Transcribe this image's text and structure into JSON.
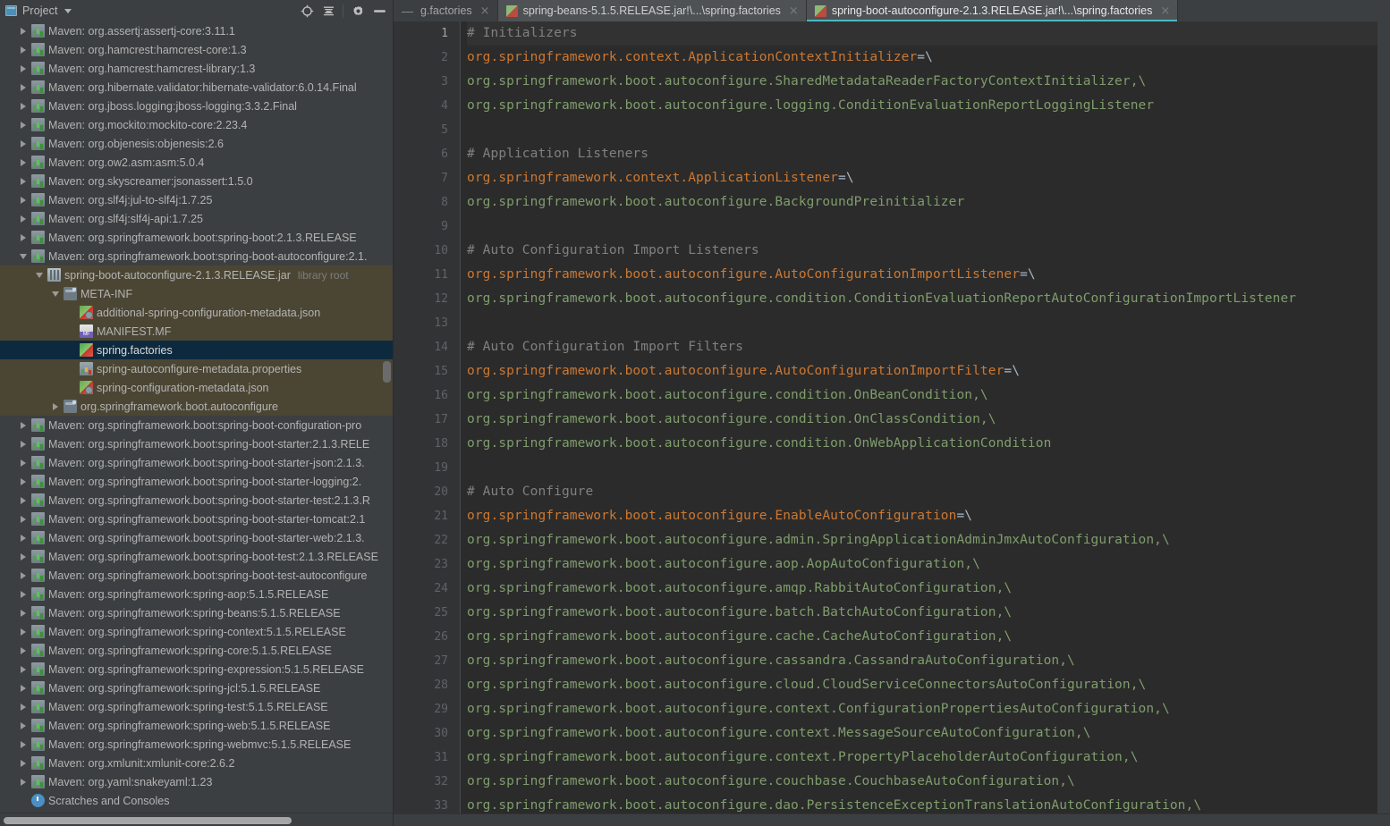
{
  "tool_window": {
    "title": "Project",
    "dropdown_caret": "chevron-down",
    "actions": [
      {
        "name": "locate-icon",
        "glyph": "⊕"
      },
      {
        "name": "collapse-all-icon",
        "glyph": "≡"
      },
      {
        "name": "settings-gear-icon",
        "glyph": "⚙"
      },
      {
        "name": "hide-icon",
        "glyph": "—"
      }
    ]
  },
  "tabs": [
    {
      "label": "g.factories",
      "icon": "properties-file-icon",
      "state": "inactive",
      "closable": true,
      "truncated": true
    },
    {
      "label": "spring-beans-5.1.5.RELEASE.jar!\\...\\spring.factories",
      "icon": "properties-file-icon",
      "state": "active-unfocused",
      "closable": true
    },
    {
      "label": "spring-boot-autoconfigure-2.1.3.RELEASE.jar!\\...\\spring.factories",
      "icon": "properties-file-icon",
      "state": "active",
      "closable": true
    }
  ],
  "tree": [
    {
      "label": "Maven: org.assertj:assertj-core:3.11.1",
      "indent": 0,
      "twisty": "right",
      "icon": "maven-lib-icon"
    },
    {
      "label": "Maven: org.hamcrest:hamcrest-core:1.3",
      "indent": 0,
      "twisty": "right",
      "icon": "maven-lib-icon"
    },
    {
      "label": "Maven: org.hamcrest:hamcrest-library:1.3",
      "indent": 0,
      "twisty": "right",
      "icon": "maven-lib-icon"
    },
    {
      "label": "Maven: org.hibernate.validator:hibernate-validator:6.0.14.Final",
      "indent": 0,
      "twisty": "right",
      "icon": "maven-lib-icon"
    },
    {
      "label": "Maven: org.jboss.logging:jboss-logging:3.3.2.Final",
      "indent": 0,
      "twisty": "right",
      "icon": "maven-lib-icon"
    },
    {
      "label": "Maven: org.mockito:mockito-core:2.23.4",
      "indent": 0,
      "twisty": "right",
      "icon": "maven-lib-icon"
    },
    {
      "label": "Maven: org.objenesis:objenesis:2.6",
      "indent": 0,
      "twisty": "right",
      "icon": "maven-lib-icon"
    },
    {
      "label": "Maven: org.ow2.asm:asm:5.0.4",
      "indent": 0,
      "twisty": "right",
      "icon": "maven-lib-icon"
    },
    {
      "label": "Maven: org.skyscreamer:jsonassert:1.5.0",
      "indent": 0,
      "twisty": "right",
      "icon": "maven-lib-icon"
    },
    {
      "label": "Maven: org.slf4j:jul-to-slf4j:1.7.25",
      "indent": 0,
      "twisty": "right",
      "icon": "maven-lib-icon"
    },
    {
      "label": "Maven: org.slf4j:slf4j-api:1.7.25",
      "indent": 0,
      "twisty": "right",
      "icon": "maven-lib-icon"
    },
    {
      "label": "Maven: org.springframework.boot:spring-boot:2.1.3.RELEASE",
      "indent": 0,
      "twisty": "right",
      "icon": "maven-lib-icon"
    },
    {
      "label": "Maven: org.springframework.boot:spring-boot-autoconfigure:2.1.",
      "indent": 0,
      "twisty": "down",
      "icon": "maven-lib-icon"
    },
    {
      "label": "spring-boot-autoconfigure-2.1.3.RELEASE.jar",
      "sub": "library root",
      "indent": 1,
      "twisty": "down",
      "icon": "jar-icon",
      "highlight": "jar-subtree"
    },
    {
      "label": "META-INF",
      "indent": 2,
      "twisty": "down",
      "icon": "folder-icon",
      "highlight": "jar-subtree"
    },
    {
      "label": "additional-spring-configuration-metadata.json",
      "indent": 3,
      "twisty": "none",
      "icon": "json-file-icon",
      "highlight": "jar-subtree"
    },
    {
      "label": "MANIFEST.MF",
      "indent": 3,
      "twisty": "none",
      "icon": "manifest-file-icon",
      "highlight": "jar-subtree"
    },
    {
      "label": "spring.factories",
      "indent": 3,
      "twisty": "none",
      "icon": "properties-file-icon",
      "highlight": "selected"
    },
    {
      "label": "spring-autoconfigure-metadata.properties",
      "indent": 3,
      "twisty": "none",
      "icon": "properties-file-icon",
      "highlight": "jar-subtree"
    },
    {
      "label": "spring-configuration-metadata.json",
      "indent": 3,
      "twisty": "none",
      "icon": "json-file-icon",
      "highlight": "jar-subtree"
    },
    {
      "label": "org.springframework.boot.autoconfigure",
      "indent": 2,
      "twisty": "right",
      "icon": "folder-icon",
      "highlight": "jar-subtree"
    },
    {
      "label": "Maven: org.springframework.boot:spring-boot-configuration-pro",
      "indent": 0,
      "twisty": "right",
      "icon": "maven-lib-icon"
    },
    {
      "label": "Maven: org.springframework.boot:spring-boot-starter:2.1.3.RELE",
      "indent": 0,
      "twisty": "right",
      "icon": "maven-lib-icon"
    },
    {
      "label": "Maven: org.springframework.boot:spring-boot-starter-json:2.1.3.",
      "indent": 0,
      "twisty": "right",
      "icon": "maven-lib-icon"
    },
    {
      "label": "Maven: org.springframework.boot:spring-boot-starter-logging:2.",
      "indent": 0,
      "twisty": "right",
      "icon": "maven-lib-icon"
    },
    {
      "label": "Maven: org.springframework.boot:spring-boot-starter-test:2.1.3.R",
      "indent": 0,
      "twisty": "right",
      "icon": "maven-lib-icon"
    },
    {
      "label": "Maven: org.springframework.boot:spring-boot-starter-tomcat:2.1",
      "indent": 0,
      "twisty": "right",
      "icon": "maven-lib-icon"
    },
    {
      "label": "Maven: org.springframework.boot:spring-boot-starter-web:2.1.3.",
      "indent": 0,
      "twisty": "right",
      "icon": "maven-lib-icon"
    },
    {
      "label": "Maven: org.springframework.boot:spring-boot-test:2.1.3.RELEASE",
      "indent": 0,
      "twisty": "right",
      "icon": "maven-lib-icon"
    },
    {
      "label": "Maven: org.springframework.boot:spring-boot-test-autoconfigure",
      "indent": 0,
      "twisty": "right",
      "icon": "maven-lib-icon"
    },
    {
      "label": "Maven: org.springframework:spring-aop:5.1.5.RELEASE",
      "indent": 0,
      "twisty": "right",
      "icon": "maven-lib-icon"
    },
    {
      "label": "Maven: org.springframework:spring-beans:5.1.5.RELEASE",
      "indent": 0,
      "twisty": "right",
      "icon": "maven-lib-icon"
    },
    {
      "label": "Maven: org.springframework:spring-context:5.1.5.RELEASE",
      "indent": 0,
      "twisty": "right",
      "icon": "maven-lib-icon"
    },
    {
      "label": "Maven: org.springframework:spring-core:5.1.5.RELEASE",
      "indent": 0,
      "twisty": "right",
      "icon": "maven-lib-icon"
    },
    {
      "label": "Maven: org.springframework:spring-expression:5.1.5.RELEASE",
      "indent": 0,
      "twisty": "right",
      "icon": "maven-lib-icon"
    },
    {
      "label": "Maven: org.springframework:spring-jcl:5.1.5.RELEASE",
      "indent": 0,
      "twisty": "right",
      "icon": "maven-lib-icon"
    },
    {
      "label": "Maven: org.springframework:spring-test:5.1.5.RELEASE",
      "indent": 0,
      "twisty": "right",
      "icon": "maven-lib-icon"
    },
    {
      "label": "Maven: org.springframework:spring-web:5.1.5.RELEASE",
      "indent": 0,
      "twisty": "right",
      "icon": "maven-lib-icon"
    },
    {
      "label": "Maven: org.springframework:spring-webmvc:5.1.5.RELEASE",
      "indent": 0,
      "twisty": "right",
      "icon": "maven-lib-icon"
    },
    {
      "label": "Maven: org.xmlunit:xmlunit-core:2.6.2",
      "indent": 0,
      "twisty": "right",
      "icon": "maven-lib-icon"
    },
    {
      "label": "Maven: org.yaml:snakeyaml:1.23",
      "indent": 0,
      "twisty": "right",
      "icon": "maven-lib-icon"
    },
    {
      "label": "Scratches and Consoles",
      "indent": 0,
      "twisty": "none",
      "icon": "scratches-icon"
    }
  ],
  "editor": {
    "first_visible_line": 1,
    "caret_line": 1,
    "lines": [
      {
        "n": 1,
        "segments": [
          {
            "t": "# Initializers",
            "c": "comment"
          }
        ]
      },
      {
        "n": 2,
        "segments": [
          {
            "t": "org.springframework.context.ApplicationContextInitializer",
            "c": "key"
          },
          {
            "t": "=\\",
            "c": "eq"
          }
        ]
      },
      {
        "n": 3,
        "segments": [
          {
            "t": "org.springframework.boot.autoconfigure.SharedMetadataReaderFactoryContextInitializer,\\",
            "c": "val"
          }
        ]
      },
      {
        "n": 4,
        "segments": [
          {
            "t": "org.springframework.boot.autoconfigure.logging.ConditionEvaluationReportLoggingListener",
            "c": "val"
          }
        ]
      },
      {
        "n": 5,
        "segments": []
      },
      {
        "n": 6,
        "segments": [
          {
            "t": "# Application Listeners",
            "c": "comment"
          }
        ]
      },
      {
        "n": 7,
        "segments": [
          {
            "t": "org.springframework.context.ApplicationListener",
            "c": "key"
          },
          {
            "t": "=\\",
            "c": "eq"
          }
        ]
      },
      {
        "n": 8,
        "segments": [
          {
            "t": "org.springframework.boot.autoconfigure.BackgroundPreinitializer",
            "c": "val"
          }
        ]
      },
      {
        "n": 9,
        "segments": []
      },
      {
        "n": 10,
        "segments": [
          {
            "t": "# Auto Configuration Import Listeners",
            "c": "comment"
          }
        ]
      },
      {
        "n": 11,
        "segments": [
          {
            "t": "org.springframework.boot.autoconfigure.AutoConfigurationImportListener",
            "c": "key"
          },
          {
            "t": "=\\",
            "c": "eq"
          }
        ]
      },
      {
        "n": 12,
        "segments": [
          {
            "t": "org.springframework.boot.autoconfigure.condition.ConditionEvaluationReportAutoConfigurationImportListener",
            "c": "val"
          }
        ]
      },
      {
        "n": 13,
        "segments": []
      },
      {
        "n": 14,
        "segments": [
          {
            "t": "# Auto Configuration Import Filters",
            "c": "comment"
          }
        ]
      },
      {
        "n": 15,
        "segments": [
          {
            "t": "org.springframework.boot.autoconfigure.AutoConfigurationImportFilter",
            "c": "key"
          },
          {
            "t": "=\\",
            "c": "eq"
          }
        ]
      },
      {
        "n": 16,
        "segments": [
          {
            "t": "org.springframework.boot.autoconfigure.condition.OnBeanCondition,\\",
            "c": "val"
          }
        ]
      },
      {
        "n": 17,
        "segments": [
          {
            "t": "org.springframework.boot.autoconfigure.condition.OnClassCondition,\\",
            "c": "val"
          }
        ]
      },
      {
        "n": 18,
        "segments": [
          {
            "t": "org.springframework.boot.autoconfigure.condition.OnWebApplicationCondition",
            "c": "val"
          }
        ]
      },
      {
        "n": 19,
        "segments": []
      },
      {
        "n": 20,
        "segments": [
          {
            "t": "# Auto Configure",
            "c": "comment"
          }
        ]
      },
      {
        "n": 21,
        "segments": [
          {
            "t": "org.springframework.boot.autoconfigure.EnableAutoConfiguration",
            "c": "key"
          },
          {
            "t": "=\\",
            "c": "eq"
          }
        ]
      },
      {
        "n": 22,
        "segments": [
          {
            "t": "org.springframework.boot.autoconfigure.admin.SpringApplicationAdminJmxAutoConfiguration,\\",
            "c": "val"
          }
        ]
      },
      {
        "n": 23,
        "segments": [
          {
            "t": "org.springframework.boot.autoconfigure.aop.AopAutoConfiguration,\\",
            "c": "val"
          }
        ]
      },
      {
        "n": 24,
        "segments": [
          {
            "t": "org.springframework.boot.autoconfigure.amqp.RabbitAutoConfiguration,\\",
            "c": "val"
          }
        ]
      },
      {
        "n": 25,
        "segments": [
          {
            "t": "org.springframework.boot.autoconfigure.batch.BatchAutoConfiguration,\\",
            "c": "val"
          }
        ]
      },
      {
        "n": 26,
        "segments": [
          {
            "t": "org.springframework.boot.autoconfigure.cache.CacheAutoConfiguration,\\",
            "c": "val"
          }
        ]
      },
      {
        "n": 27,
        "segments": [
          {
            "t": "org.springframework.boot.autoconfigure.cassandra.CassandraAutoConfiguration,\\",
            "c": "val"
          }
        ]
      },
      {
        "n": 28,
        "segments": [
          {
            "t": "org.springframework.boot.autoconfigure.cloud.CloudServiceConnectorsAutoConfiguration,\\",
            "c": "val"
          }
        ]
      },
      {
        "n": 29,
        "segments": [
          {
            "t": "org.springframework.boot.autoconfigure.context.ConfigurationPropertiesAutoConfiguration,\\",
            "c": "val"
          }
        ]
      },
      {
        "n": 30,
        "segments": [
          {
            "t": "org.springframework.boot.autoconfigure.context.MessageSourceAutoConfiguration,\\",
            "c": "val"
          }
        ]
      },
      {
        "n": 31,
        "segments": [
          {
            "t": "org.springframework.boot.autoconfigure.context.PropertyPlaceholderAutoConfiguration,\\",
            "c": "val"
          }
        ]
      },
      {
        "n": 32,
        "segments": [
          {
            "t": "org.springframework.boot.autoconfigure.couchbase.CouchbaseAutoConfiguration,\\",
            "c": "val"
          }
        ]
      },
      {
        "n": 33,
        "segments": [
          {
            "t": "org.springframework.boot.autoconfigure.dao.PersistenceExceptionTranslationAutoConfiguration,\\",
            "c": "val"
          }
        ]
      }
    ]
  },
  "colors": {
    "background": "#3c3f41",
    "editor_background": "#2b2b2b",
    "gutter_background": "#313335",
    "key_color": "#cc7832",
    "value_color": "#7f9d6c",
    "comment_color": "#808080",
    "selection_color": "#0d293e",
    "jar_subtree_color": "#4b4634",
    "active_tab_underline": "#4ab9c2"
  }
}
